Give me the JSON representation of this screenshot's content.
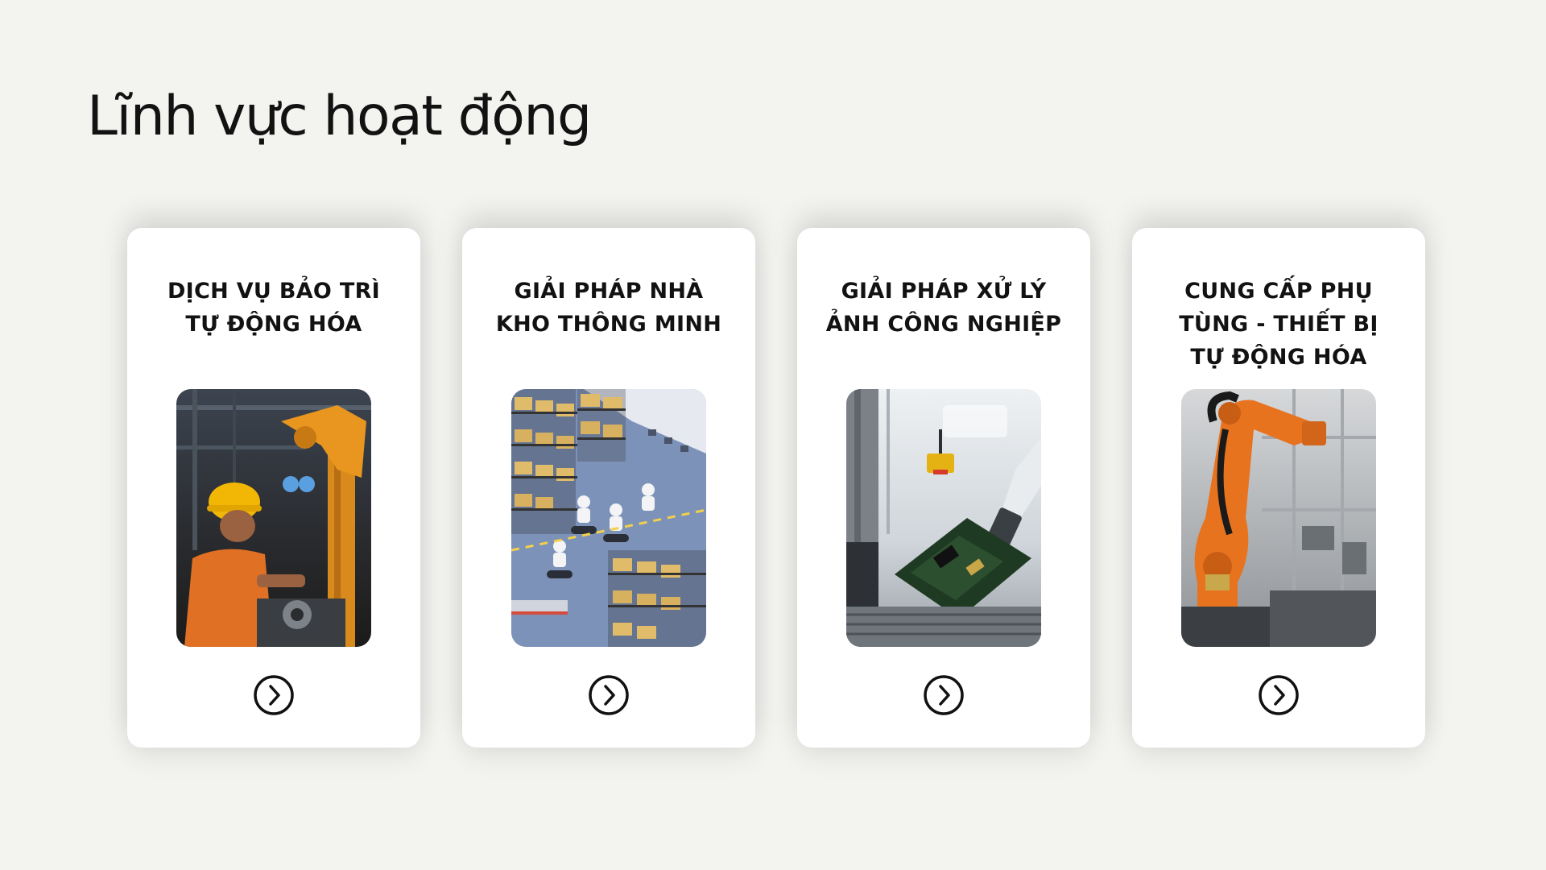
{
  "page": {
    "title": "Lĩnh vực hoạt động"
  },
  "cards": [
    {
      "title": "DỊCH VỤ BẢO TRÌ TỰ ĐỘNG HÓA",
      "image": "worker-repairing-robot-arm-photo",
      "action_icon": "chevron-right-circle-icon"
    },
    {
      "title": "GIẢI PHÁP NHÀ KHO THÔNG MINH",
      "image": "smart-warehouse-robots-illustration",
      "action_icon": "chevron-right-circle-icon"
    },
    {
      "title": "GIẢI PHÁP XỬ LÝ ẢNH CÔNG NGHIỆP",
      "image": "machine-vision-circuit-board-photo",
      "action_icon": "chevron-right-circle-icon"
    },
    {
      "title": "CUNG CẤP PHỤ TÙNG - THIẾT BỊ TỰ ĐỘNG HÓA",
      "image": "orange-industrial-robot-arm-photo",
      "action_icon": "chevron-right-circle-icon"
    }
  ],
  "colors": {
    "background": "#f3f3f0",
    "card": "#ffffff",
    "text": "#121212",
    "robot_orange": "#e8731f",
    "warehouse_blue": "#7d92b8"
  }
}
